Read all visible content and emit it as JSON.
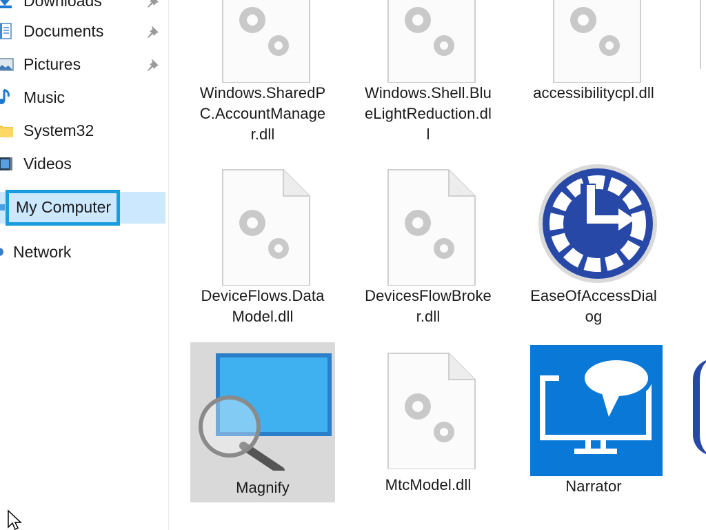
{
  "nav": {
    "items": [
      {
        "label": "Downloads",
        "icon": "downloads-icon",
        "pinned": true
      },
      {
        "label": "Documents",
        "icon": "documents-icon",
        "pinned": true
      },
      {
        "label": "Pictures",
        "icon": "pictures-icon",
        "pinned": true
      },
      {
        "label": "Music",
        "icon": "music-icon",
        "pinned": false
      },
      {
        "label": "System32",
        "icon": "folder-icon",
        "pinned": false
      },
      {
        "label": "Videos",
        "icon": "videos-icon",
        "pinned": false
      },
      {
        "label": "My Computer",
        "icon": "computer-icon",
        "selected": true
      },
      {
        "label": "Network",
        "icon": "network-icon",
        "pinned": false
      }
    ]
  },
  "files": [
    {
      "name": "Windows.SharedPC.AccountManager.dll",
      "icon": "dll-gear-icon"
    },
    {
      "name": "Windows.Shell.BlueLightReduction.dll",
      "icon": "dll-gear-icon"
    },
    {
      "name": "accessibilitycpl.dll",
      "icon": "dll-gear-icon"
    },
    {
      "name": "DeviceFlows.DataModel.dll",
      "icon": "dll-gear-icon"
    },
    {
      "name": "DevicesFlowBroker.dll",
      "icon": "dll-gear-icon"
    },
    {
      "name": "EaseOfAccessDialog",
      "icon": "ease-of-access-icon"
    },
    {
      "name": "Magnify",
      "icon": "magnifier-icon",
      "selected": true
    },
    {
      "name": "MtcModel.dll",
      "icon": "dll-gear-icon"
    },
    {
      "name": "Narrator",
      "icon": "narrator-icon"
    }
  ],
  "colors": {
    "selection_background": "#cce8ff",
    "focus_border": "#1a9dde",
    "item_selected_background": "#d9d9d9",
    "narrator_tile": "#0a78d7",
    "ease_of_access_blue": "#2848a8"
  }
}
